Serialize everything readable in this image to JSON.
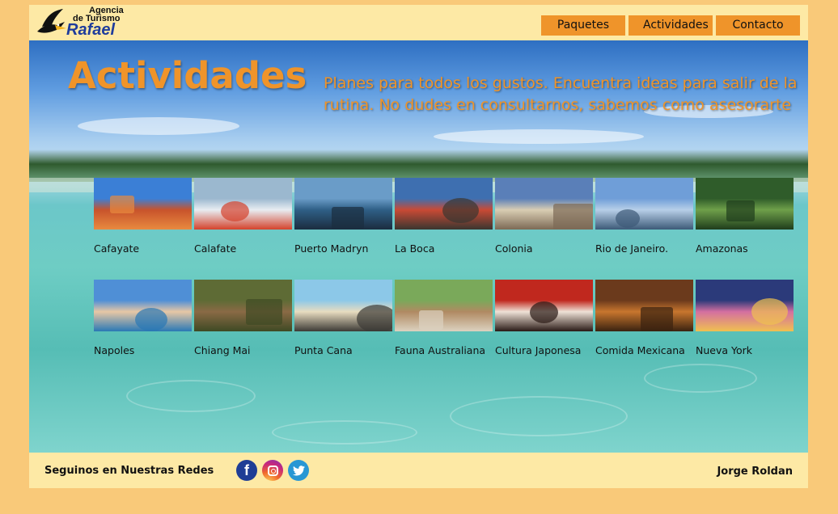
{
  "header": {
    "logo": {
      "line1": "Agencia",
      "line2": "de Turismo",
      "line3": "Rafael"
    },
    "nav": [
      {
        "label": "Paquetes"
      },
      {
        "label": "Actividades"
      },
      {
        "label": "Contacto"
      }
    ]
  },
  "hero": {
    "title": "Actividades",
    "subtitle": "Planes para todos los gustos. Encuentra ideas para salir de la rutina. No dudes en consultarnos, sabemos como asesorarte"
  },
  "activities": [
    {
      "label": "Cafayate",
      "colors": [
        "#3b7fd6",
        "#c8532b",
        "#e88a3f"
      ]
    },
    {
      "label": "Calafate",
      "colors": [
        "#9bb8cf",
        "#e8edf2",
        "#d4422c"
      ]
    },
    {
      "label": "Puerto Madryn",
      "colors": [
        "#6a9cc8",
        "#2f5f86",
        "#1b2d3f"
      ]
    },
    {
      "label": "La Boca",
      "colors": [
        "#3e6fb0",
        "#c94a35",
        "#3a3630"
      ]
    },
    {
      "label": "Colonia",
      "colors": [
        "#5a7fb8",
        "#d9cdb3",
        "#7c6a55"
      ]
    },
    {
      "label": "Rio de Janeiro.",
      "colors": [
        "#6f9ed8",
        "#b7cfe8",
        "#3d5a78"
      ]
    },
    {
      "label": "Amazonas",
      "colors": [
        "#2f5c2a",
        "#6fa04a",
        "#1f3d1c"
      ]
    },
    {
      "label": "Napoles",
      "colors": [
        "#4f8fd6",
        "#e7c7a5",
        "#2a78b5"
      ]
    },
    {
      "label": "Chiang Mai",
      "colors": [
        "#5e6b35",
        "#8a6a45",
        "#3e4a24"
      ]
    },
    {
      "label": "Punta Cana",
      "colors": [
        "#8cc8e8",
        "#e8dcc0",
        "#3c3a36"
      ]
    },
    {
      "label": "Fauna Australiana",
      "colors": [
        "#7aa95a",
        "#b08a62",
        "#dcd2c0"
      ]
    },
    {
      "label": "Cultura Japonesa",
      "colors": [
        "#c0281e",
        "#efe2d6",
        "#2a1a16"
      ]
    },
    {
      "label": "Comida Mexicana",
      "colors": [
        "#6b3a1c",
        "#c8762e",
        "#3a2210"
      ]
    },
    {
      "label": "Nueva York",
      "colors": [
        "#2b3a7a",
        "#d46fa0",
        "#f0c050"
      ]
    }
  ],
  "footer": {
    "follow_text": "Seguinos en Nuestras Redes",
    "author": "Jorge Roldan",
    "socials": [
      {
        "name": "facebook-icon",
        "glyph": "f"
      },
      {
        "name": "instagram-icon",
        "glyph": ""
      },
      {
        "name": "twitter-icon",
        "glyph": "t"
      }
    ]
  }
}
